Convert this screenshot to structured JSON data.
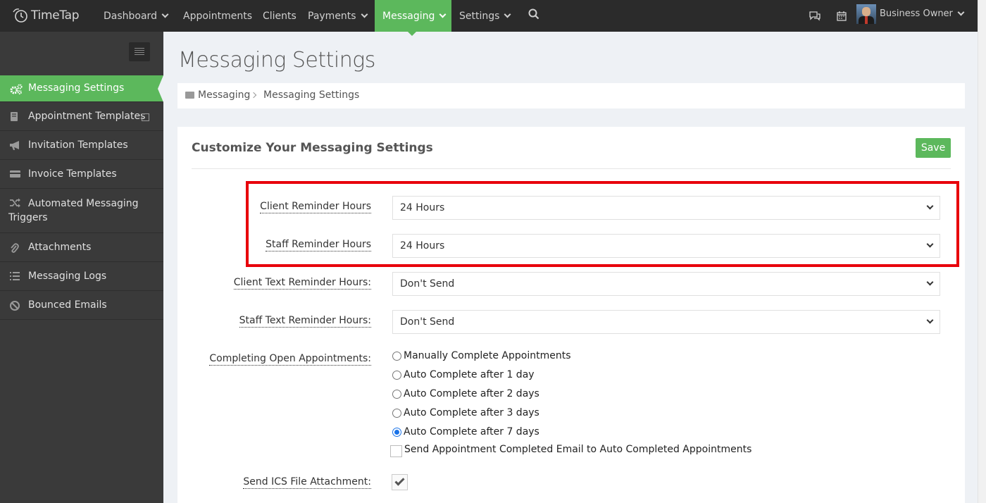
{
  "app": {
    "logo_text": "TimeTap"
  },
  "nav": {
    "items": [
      {
        "label": "Dashboard",
        "has_dropdown": true
      },
      {
        "label": "Appointments",
        "has_dropdown": false
      },
      {
        "label": "Clients",
        "has_dropdown": false
      },
      {
        "label": "Payments",
        "has_dropdown": true
      },
      {
        "label": "Messaging",
        "has_dropdown": true,
        "active": true
      },
      {
        "label": "Settings",
        "has_dropdown": true
      }
    ],
    "user_name": "Business Owner",
    "icons": [
      "search-icon",
      "chat-icon",
      "calendar-icon"
    ],
    "accent_color": "#5cb85c"
  },
  "sidebar": {
    "items": [
      {
        "label": "Messaging Settings",
        "icon": "cogs-icon",
        "active": true
      },
      {
        "label": "Appointment Templates",
        "icon": "book-icon"
      },
      {
        "label": "Invitation Templates",
        "icon": "bullhorn-icon"
      },
      {
        "label": "Invoice Templates",
        "icon": "credit-card-icon"
      },
      {
        "label": "Automated Messaging Triggers",
        "icon": "random-icon"
      },
      {
        "label": "Attachments",
        "icon": "paperclip-icon"
      },
      {
        "label": "Messaging Logs",
        "icon": "list-icon"
      },
      {
        "label": "Bounced Emails",
        "icon": "ban-icon"
      }
    ]
  },
  "page": {
    "title": "Messaging Settings",
    "breadcrumb": [
      "Messaging",
      "Messaging Settings"
    ]
  },
  "panel": {
    "title": "Customize Your Messaging Settings",
    "save_label": "Save"
  },
  "form": {
    "client_reminder": {
      "label": "Client Reminder Hours",
      "value": "24 Hours"
    },
    "staff_reminder": {
      "label": "Staff Reminder Hours",
      "value": "24 Hours"
    },
    "client_text_reminder": {
      "label": "Client Text Reminder Hours:",
      "value": "Don't Send"
    },
    "staff_text_reminder": {
      "label": "Staff Text Reminder Hours:",
      "value": "Don't Send"
    },
    "completing": {
      "label": "Completing Open Appointments:",
      "options": [
        "Manually Complete Appointments",
        "Auto Complete after 1 day",
        "Auto Complete after 2 days",
        "Auto Complete after 3 days",
        "Auto Complete after 7 days"
      ],
      "selected": "Auto Complete after 7 days",
      "send_completed_email_label": "Send Appointment Completed Email to Auto Completed Appointments",
      "send_completed_email_checked": false
    },
    "ics": {
      "label": "Send ICS File Attachment:",
      "checked": true
    }
  },
  "highlight_color": "#e8000b"
}
